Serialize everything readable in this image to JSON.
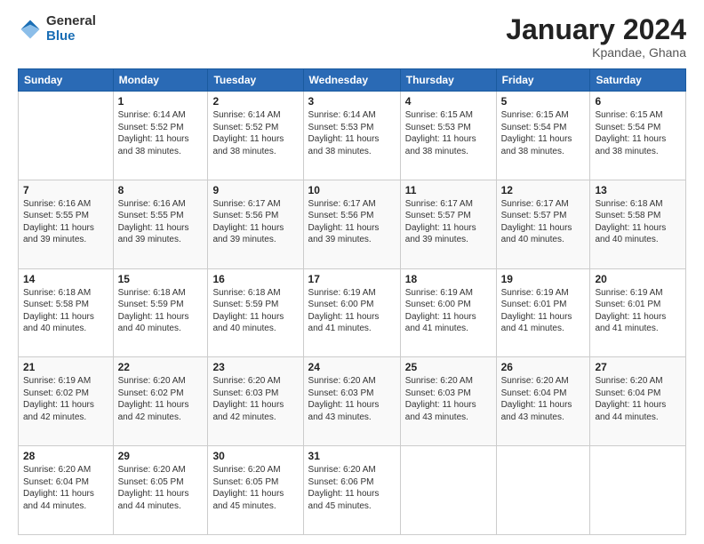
{
  "logo": {
    "general": "General",
    "blue": "Blue"
  },
  "title": "January 2024",
  "subtitle": "Kpandae, Ghana",
  "calendar": {
    "headers": [
      "Sunday",
      "Monday",
      "Tuesday",
      "Wednesday",
      "Thursday",
      "Friday",
      "Saturday"
    ],
    "weeks": [
      [
        {
          "day": "",
          "info": ""
        },
        {
          "day": "1",
          "info": "Sunrise: 6:14 AM\nSunset: 5:52 PM\nDaylight: 11 hours\nand 38 minutes."
        },
        {
          "day": "2",
          "info": "Sunrise: 6:14 AM\nSunset: 5:52 PM\nDaylight: 11 hours\nand 38 minutes."
        },
        {
          "day": "3",
          "info": "Sunrise: 6:14 AM\nSunset: 5:53 PM\nDaylight: 11 hours\nand 38 minutes."
        },
        {
          "day": "4",
          "info": "Sunrise: 6:15 AM\nSunset: 5:53 PM\nDaylight: 11 hours\nand 38 minutes."
        },
        {
          "day": "5",
          "info": "Sunrise: 6:15 AM\nSunset: 5:54 PM\nDaylight: 11 hours\nand 38 minutes."
        },
        {
          "day": "6",
          "info": "Sunrise: 6:15 AM\nSunset: 5:54 PM\nDaylight: 11 hours\nand 38 minutes."
        }
      ],
      [
        {
          "day": "7",
          "info": "Sunrise: 6:16 AM\nSunset: 5:55 PM\nDaylight: 11 hours\nand 39 minutes."
        },
        {
          "day": "8",
          "info": "Sunrise: 6:16 AM\nSunset: 5:55 PM\nDaylight: 11 hours\nand 39 minutes."
        },
        {
          "day": "9",
          "info": "Sunrise: 6:17 AM\nSunset: 5:56 PM\nDaylight: 11 hours\nand 39 minutes."
        },
        {
          "day": "10",
          "info": "Sunrise: 6:17 AM\nSunset: 5:56 PM\nDaylight: 11 hours\nand 39 minutes."
        },
        {
          "day": "11",
          "info": "Sunrise: 6:17 AM\nSunset: 5:57 PM\nDaylight: 11 hours\nand 39 minutes."
        },
        {
          "day": "12",
          "info": "Sunrise: 6:17 AM\nSunset: 5:57 PM\nDaylight: 11 hours\nand 40 minutes."
        },
        {
          "day": "13",
          "info": "Sunrise: 6:18 AM\nSunset: 5:58 PM\nDaylight: 11 hours\nand 40 minutes."
        }
      ],
      [
        {
          "day": "14",
          "info": "Sunrise: 6:18 AM\nSunset: 5:58 PM\nDaylight: 11 hours\nand 40 minutes."
        },
        {
          "day": "15",
          "info": "Sunrise: 6:18 AM\nSunset: 5:59 PM\nDaylight: 11 hours\nand 40 minutes."
        },
        {
          "day": "16",
          "info": "Sunrise: 6:18 AM\nSunset: 5:59 PM\nDaylight: 11 hours\nand 40 minutes."
        },
        {
          "day": "17",
          "info": "Sunrise: 6:19 AM\nSunset: 6:00 PM\nDaylight: 11 hours\nand 41 minutes."
        },
        {
          "day": "18",
          "info": "Sunrise: 6:19 AM\nSunset: 6:00 PM\nDaylight: 11 hours\nand 41 minutes."
        },
        {
          "day": "19",
          "info": "Sunrise: 6:19 AM\nSunset: 6:01 PM\nDaylight: 11 hours\nand 41 minutes."
        },
        {
          "day": "20",
          "info": "Sunrise: 6:19 AM\nSunset: 6:01 PM\nDaylight: 11 hours\nand 41 minutes."
        }
      ],
      [
        {
          "day": "21",
          "info": "Sunrise: 6:19 AM\nSunset: 6:02 PM\nDaylight: 11 hours\nand 42 minutes."
        },
        {
          "day": "22",
          "info": "Sunrise: 6:20 AM\nSunset: 6:02 PM\nDaylight: 11 hours\nand 42 minutes."
        },
        {
          "day": "23",
          "info": "Sunrise: 6:20 AM\nSunset: 6:03 PM\nDaylight: 11 hours\nand 42 minutes."
        },
        {
          "day": "24",
          "info": "Sunrise: 6:20 AM\nSunset: 6:03 PM\nDaylight: 11 hours\nand 43 minutes."
        },
        {
          "day": "25",
          "info": "Sunrise: 6:20 AM\nSunset: 6:03 PM\nDaylight: 11 hours\nand 43 minutes."
        },
        {
          "day": "26",
          "info": "Sunrise: 6:20 AM\nSunset: 6:04 PM\nDaylight: 11 hours\nand 43 minutes."
        },
        {
          "day": "27",
          "info": "Sunrise: 6:20 AM\nSunset: 6:04 PM\nDaylight: 11 hours\nand 44 minutes."
        }
      ],
      [
        {
          "day": "28",
          "info": "Sunrise: 6:20 AM\nSunset: 6:04 PM\nDaylight: 11 hours\nand 44 minutes."
        },
        {
          "day": "29",
          "info": "Sunrise: 6:20 AM\nSunset: 6:05 PM\nDaylight: 11 hours\nand 44 minutes."
        },
        {
          "day": "30",
          "info": "Sunrise: 6:20 AM\nSunset: 6:05 PM\nDaylight: 11 hours\nand 45 minutes."
        },
        {
          "day": "31",
          "info": "Sunrise: 6:20 AM\nSunset: 6:06 PM\nDaylight: 11 hours\nand 45 minutes."
        },
        {
          "day": "",
          "info": ""
        },
        {
          "day": "",
          "info": ""
        },
        {
          "day": "",
          "info": ""
        }
      ]
    ]
  }
}
